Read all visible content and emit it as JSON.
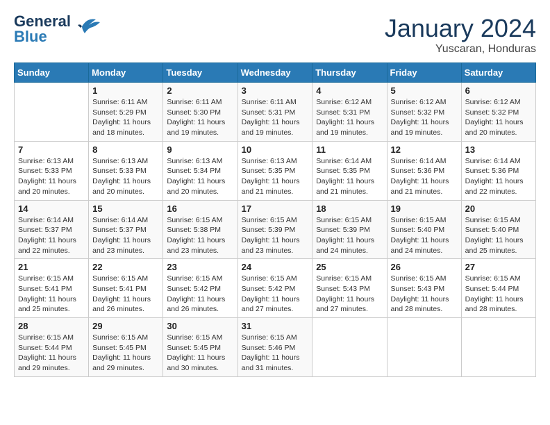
{
  "header": {
    "logo_line1": "General",
    "logo_line2": "Blue",
    "month": "January 2024",
    "location": "Yuscaran, Honduras"
  },
  "weekdays": [
    "Sunday",
    "Monday",
    "Tuesday",
    "Wednesday",
    "Thursday",
    "Friday",
    "Saturday"
  ],
  "weeks": [
    [
      {
        "day": "",
        "info": ""
      },
      {
        "day": "1",
        "info": "Sunrise: 6:11 AM\nSunset: 5:29 PM\nDaylight: 11 hours\nand 18 minutes."
      },
      {
        "day": "2",
        "info": "Sunrise: 6:11 AM\nSunset: 5:30 PM\nDaylight: 11 hours\nand 19 minutes."
      },
      {
        "day": "3",
        "info": "Sunrise: 6:11 AM\nSunset: 5:31 PM\nDaylight: 11 hours\nand 19 minutes."
      },
      {
        "day": "4",
        "info": "Sunrise: 6:12 AM\nSunset: 5:31 PM\nDaylight: 11 hours\nand 19 minutes."
      },
      {
        "day": "5",
        "info": "Sunrise: 6:12 AM\nSunset: 5:32 PM\nDaylight: 11 hours\nand 19 minutes."
      },
      {
        "day": "6",
        "info": "Sunrise: 6:12 AM\nSunset: 5:32 PM\nDaylight: 11 hours\nand 20 minutes."
      }
    ],
    [
      {
        "day": "7",
        "info": "Sunrise: 6:13 AM\nSunset: 5:33 PM\nDaylight: 11 hours\nand 20 minutes."
      },
      {
        "day": "8",
        "info": "Sunrise: 6:13 AM\nSunset: 5:33 PM\nDaylight: 11 hours\nand 20 minutes."
      },
      {
        "day": "9",
        "info": "Sunrise: 6:13 AM\nSunset: 5:34 PM\nDaylight: 11 hours\nand 20 minutes."
      },
      {
        "day": "10",
        "info": "Sunrise: 6:13 AM\nSunset: 5:35 PM\nDaylight: 11 hours\nand 21 minutes."
      },
      {
        "day": "11",
        "info": "Sunrise: 6:14 AM\nSunset: 5:35 PM\nDaylight: 11 hours\nand 21 minutes."
      },
      {
        "day": "12",
        "info": "Sunrise: 6:14 AM\nSunset: 5:36 PM\nDaylight: 11 hours\nand 21 minutes."
      },
      {
        "day": "13",
        "info": "Sunrise: 6:14 AM\nSunset: 5:36 PM\nDaylight: 11 hours\nand 22 minutes."
      }
    ],
    [
      {
        "day": "14",
        "info": "Sunrise: 6:14 AM\nSunset: 5:37 PM\nDaylight: 11 hours\nand 22 minutes."
      },
      {
        "day": "15",
        "info": "Sunrise: 6:14 AM\nSunset: 5:37 PM\nDaylight: 11 hours\nand 23 minutes."
      },
      {
        "day": "16",
        "info": "Sunrise: 6:15 AM\nSunset: 5:38 PM\nDaylight: 11 hours\nand 23 minutes."
      },
      {
        "day": "17",
        "info": "Sunrise: 6:15 AM\nSunset: 5:39 PM\nDaylight: 11 hours\nand 23 minutes."
      },
      {
        "day": "18",
        "info": "Sunrise: 6:15 AM\nSunset: 5:39 PM\nDaylight: 11 hours\nand 24 minutes."
      },
      {
        "day": "19",
        "info": "Sunrise: 6:15 AM\nSunset: 5:40 PM\nDaylight: 11 hours\nand 24 minutes."
      },
      {
        "day": "20",
        "info": "Sunrise: 6:15 AM\nSunset: 5:40 PM\nDaylight: 11 hours\nand 25 minutes."
      }
    ],
    [
      {
        "day": "21",
        "info": "Sunrise: 6:15 AM\nSunset: 5:41 PM\nDaylight: 11 hours\nand 25 minutes."
      },
      {
        "day": "22",
        "info": "Sunrise: 6:15 AM\nSunset: 5:41 PM\nDaylight: 11 hours\nand 26 minutes."
      },
      {
        "day": "23",
        "info": "Sunrise: 6:15 AM\nSunset: 5:42 PM\nDaylight: 11 hours\nand 26 minutes."
      },
      {
        "day": "24",
        "info": "Sunrise: 6:15 AM\nSunset: 5:42 PM\nDaylight: 11 hours\nand 27 minutes."
      },
      {
        "day": "25",
        "info": "Sunrise: 6:15 AM\nSunset: 5:43 PM\nDaylight: 11 hours\nand 27 minutes."
      },
      {
        "day": "26",
        "info": "Sunrise: 6:15 AM\nSunset: 5:43 PM\nDaylight: 11 hours\nand 28 minutes."
      },
      {
        "day": "27",
        "info": "Sunrise: 6:15 AM\nSunset: 5:44 PM\nDaylight: 11 hours\nand 28 minutes."
      }
    ],
    [
      {
        "day": "28",
        "info": "Sunrise: 6:15 AM\nSunset: 5:44 PM\nDaylight: 11 hours\nand 29 minutes."
      },
      {
        "day": "29",
        "info": "Sunrise: 6:15 AM\nSunset: 5:45 PM\nDaylight: 11 hours\nand 29 minutes."
      },
      {
        "day": "30",
        "info": "Sunrise: 6:15 AM\nSunset: 5:45 PM\nDaylight: 11 hours\nand 30 minutes."
      },
      {
        "day": "31",
        "info": "Sunrise: 6:15 AM\nSunset: 5:46 PM\nDaylight: 11 hours\nand 31 minutes."
      },
      {
        "day": "",
        "info": ""
      },
      {
        "day": "",
        "info": ""
      },
      {
        "day": "",
        "info": ""
      }
    ]
  ]
}
